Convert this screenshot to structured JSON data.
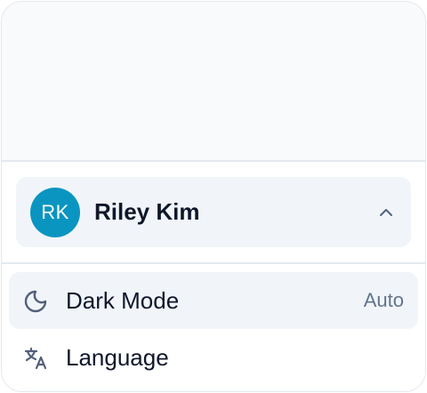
{
  "user": {
    "initials": "RK",
    "name": "Riley Kim",
    "avatar_color": "#0a95c1",
    "toggle_icon": "chevron-up-icon"
  },
  "menu": {
    "items": [
      {
        "label": "Dark Mode",
        "value": "Auto",
        "icon": "moon-icon",
        "active": true
      },
      {
        "label": "Language",
        "icon": "translate-icon",
        "active": false
      }
    ]
  },
  "colors": {
    "text_primary": "#0f172a",
    "text_secondary": "#64748b",
    "icon": "#52607a",
    "hover_bg": "#f1f5f9",
    "border": "#e3e9ef"
  }
}
